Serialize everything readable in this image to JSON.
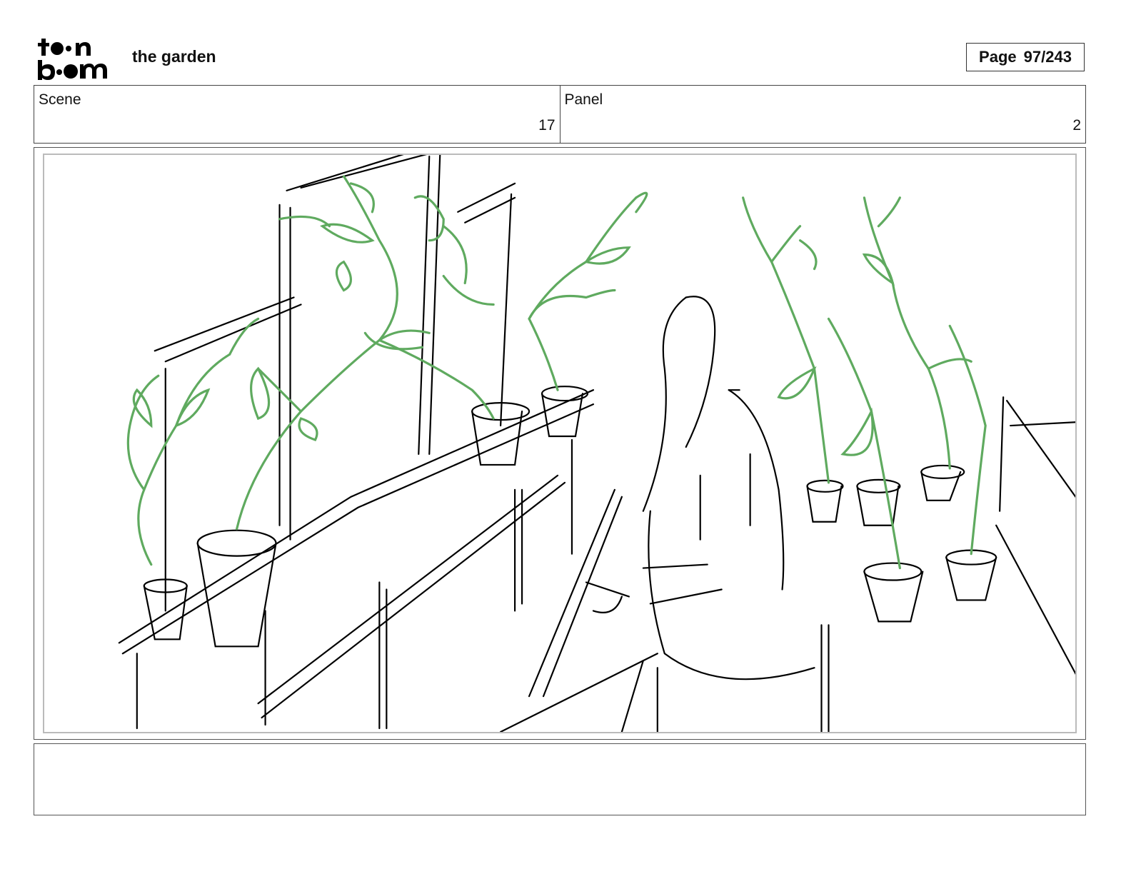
{
  "header": {
    "logo": {
      "line1": "toon",
      "line2": "boom"
    },
    "project_title": "the garden",
    "page_label": "Page",
    "page_value": "97/243"
  },
  "info": {
    "scene_label": "Scene",
    "scene_value": "17",
    "panel_label": "Panel",
    "panel_value": "2"
  },
  "sketch": {
    "ink_color": "#000000",
    "plant_color": "#5faa5f"
  },
  "notes": {
    "text": ""
  }
}
